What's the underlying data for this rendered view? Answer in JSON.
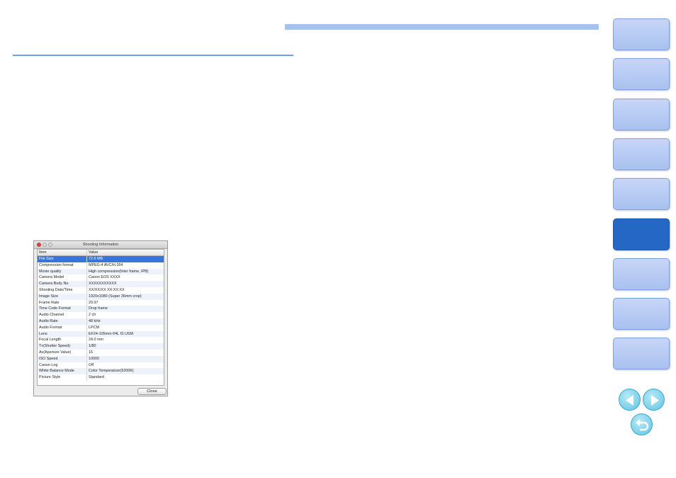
{
  "dialog": {
    "title": "Shooting Information",
    "columns": [
      "Item",
      "Value"
    ],
    "rows": [
      {
        "item": "File Size",
        "value": "72.6 MB"
      },
      {
        "item": "Compression format",
        "value": "MPEG-4 AVC/H.264"
      },
      {
        "item": "Movie quality",
        "value": "High compression(Inter frame, IPB)"
      },
      {
        "item": "Camera Model",
        "value": "Canon EOS XXXX"
      },
      {
        "item": "Camera Body No.",
        "value": "XXXXXXXXXXX"
      },
      {
        "item": "Shooting Date/Time",
        "value": "XX/XX/XX XX:XX:XX"
      },
      {
        "item": "Image Size",
        "value": "1920x1080 (Super 35mm crop)"
      },
      {
        "item": "Frame Rate",
        "value": "29.97"
      },
      {
        "item": "Time Code Format",
        "value": "Drop frame"
      },
      {
        "item": "Audio Channel",
        "value": "2 ch"
      },
      {
        "item": "Audio Rate",
        "value": "48 kHz"
      },
      {
        "item": "Audio Format",
        "value": "LPCM"
      },
      {
        "item": "Lens",
        "value": "EF24-105mm f/4L IS USM"
      },
      {
        "item": "Focal Length",
        "value": "24.0 mm"
      },
      {
        "item": "Tv(Shutter Speed)",
        "value": "1/80"
      },
      {
        "item": "Av(Aperture Value)",
        "value": "16"
      },
      {
        "item": "ISO Speed",
        "value": "10000"
      },
      {
        "item": "Canon Log",
        "value": "Off"
      },
      {
        "item": "White Balance Mode",
        "value": "Color Temperature(5200K)"
      },
      {
        "item": "Picture Style",
        "value": "Standard"
      }
    ],
    "selected_row": "File Size",
    "close_label": "Close"
  },
  "side_tabs": {
    "count": 9,
    "active_tab": 6
  },
  "nav_icons": [
    "back-arrow-icon",
    "forward-arrow-icon",
    "return-icon"
  ],
  "colors": {
    "accent": "#2467c4",
    "tab": "#b4c9f2",
    "rule": "#a5c3f2",
    "selection": "#3875d7",
    "nav_button": "#5fc4e4"
  }
}
